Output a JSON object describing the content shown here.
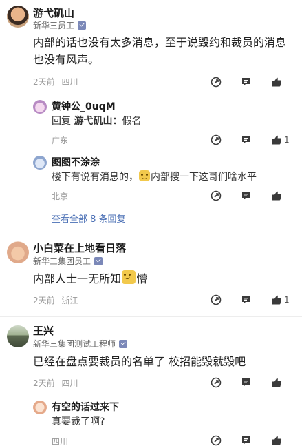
{
  "comments": [
    {
      "user": "游弋矶山",
      "title": "新华三员工",
      "body": "内部的话也没有太多消息，至于说毁约和裁员的消息也没有风声。",
      "time": "2天前",
      "location": "四川",
      "likes": "",
      "avatar_icon": "child-photo-avatar",
      "replies": [
        {
          "user": "黄钟公_0uqM",
          "reply_prefix": "回复",
          "reply_to": "游弋矶山：",
          "text": "假名",
          "location": "广东",
          "likes": "1",
          "avatar_icon": "anime-avatar"
        },
        {
          "user": "图图不涂涂",
          "text_before": "楼下有说有消息的，",
          "text_after": "内部搜一下这哥们啥水平",
          "location": "北京",
          "likes": "",
          "avatar_icon": "cartoon-avatar"
        }
      ],
      "see_all": "查看全部 8 条回复"
    },
    {
      "user": "小白菜在上地看日落",
      "title": "新华三集团员工",
      "body_before": "内部人士一无所知",
      "body_after": "懵",
      "time": "2天前",
      "location": "浙江",
      "likes": "1",
      "avatar_icon": "pig-avatar"
    },
    {
      "user": "王兴",
      "title": "新华三集团测试工程师",
      "body": "已经在盘点要裁员的名单了 校招能毁就毁吧",
      "time": "2天前",
      "location": "四川",
      "likes": "",
      "avatar_icon": "outdoor-photo-avatar",
      "replies": [
        {
          "user": "有空的话过来下",
          "text": "真要裁了啊?",
          "location": "四川",
          "likes": "",
          "avatar_icon": "pencil-avatar"
        }
      ]
    }
  ],
  "colors": {
    "link": "#4a6fb5",
    "meta": "#9a9a9a",
    "icon": "#3a3a3a",
    "verified": "#7b88b8"
  }
}
